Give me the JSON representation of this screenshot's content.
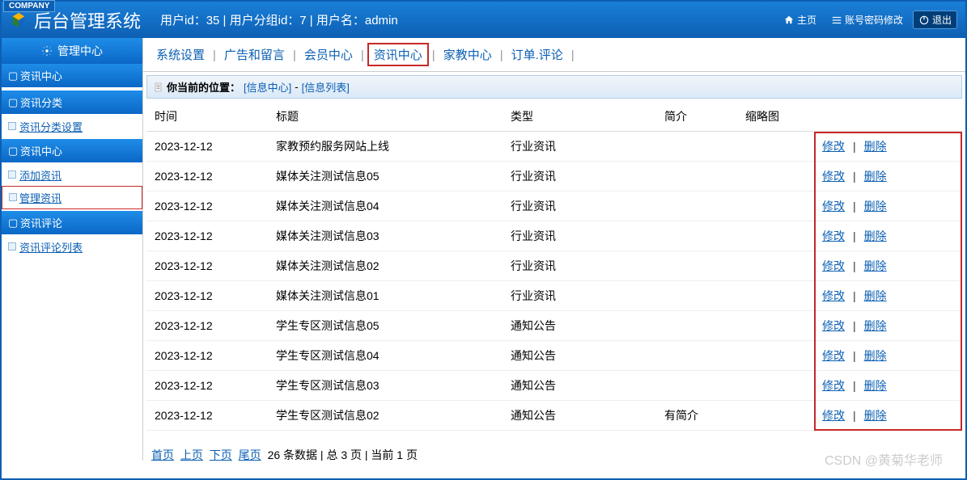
{
  "company_tag": "COMPANY",
  "app_title": "后台管理系统",
  "user_info": "用户id：35 | 用户分组id：7 | 用户名：admin",
  "titlebar_buttons": {
    "home": "主页",
    "pwd": "账号密码修改",
    "exit": "退出"
  },
  "sidebar": {
    "mc_title": "管理中心",
    "sections": [
      {
        "title": "资讯中心",
        "items": []
      },
      {
        "title": "资讯分类",
        "items": [
          {
            "label": "资讯分类设置",
            "active": false
          }
        ]
      },
      {
        "title": "资讯中心",
        "items": [
          {
            "label": "添加资讯",
            "active": false
          },
          {
            "label": "管理资讯",
            "active": true
          }
        ]
      },
      {
        "title": "资讯评论",
        "items": [
          {
            "label": "资讯评论列表",
            "active": false
          }
        ]
      }
    ]
  },
  "topnav": [
    {
      "label": "系统设置",
      "highlight": false
    },
    {
      "label": "广告和留言",
      "highlight": false
    },
    {
      "label": "会员中心",
      "highlight": false
    },
    {
      "label": "资讯中心",
      "highlight": true
    },
    {
      "label": "家教中心",
      "highlight": false
    },
    {
      "label": "订单.评论",
      "highlight": false
    }
  ],
  "breadcrumb": {
    "label": "你当前的位置：",
    "part1": "[信息中心]",
    "dash": "-",
    "part2": "[信息列表]"
  },
  "table": {
    "headers": {
      "time": "时间",
      "title": "标题",
      "type": "类型",
      "intro": "简介",
      "thumb": "缩略图"
    },
    "action_edit": "修改",
    "action_delete": "删除",
    "rows": [
      {
        "time": "2023-12-12",
        "title": "家教预约服务网站上线",
        "type": "行业资讯",
        "intro": "",
        "thumb": ""
      },
      {
        "time": "2023-12-12",
        "title": "媒体关注测试信息05",
        "type": "行业资讯",
        "intro": "",
        "thumb": ""
      },
      {
        "time": "2023-12-12",
        "title": "媒体关注测试信息04",
        "type": "行业资讯",
        "intro": "",
        "thumb": ""
      },
      {
        "time": "2023-12-12",
        "title": "媒体关注测试信息03",
        "type": "行业资讯",
        "intro": "",
        "thumb": ""
      },
      {
        "time": "2023-12-12",
        "title": "媒体关注测试信息02",
        "type": "行业资讯",
        "intro": "",
        "thumb": ""
      },
      {
        "time": "2023-12-12",
        "title": "媒体关注测试信息01",
        "type": "行业资讯",
        "intro": "",
        "thumb": ""
      },
      {
        "time": "2023-12-12",
        "title": "学生专区测试信息05",
        "type": "通知公告",
        "intro": "",
        "thumb": ""
      },
      {
        "time": "2023-12-12",
        "title": "学生专区测试信息04",
        "type": "通知公告",
        "intro": "",
        "thumb": ""
      },
      {
        "time": "2023-12-12",
        "title": "学生专区测试信息03",
        "type": "通知公告",
        "intro": "",
        "thumb": ""
      },
      {
        "time": "2023-12-12",
        "title": "学生专区测试信息02",
        "type": "通知公告",
        "intro": "有简介",
        "thumb": ""
      }
    ]
  },
  "pagination": {
    "first": "首页",
    "prev": "上页",
    "next": "下页",
    "last": "尾页",
    "summary": "26 条数据 | 总 3 页 | 当前 1 页"
  },
  "watermark": "CSDN @黄菊华老师"
}
